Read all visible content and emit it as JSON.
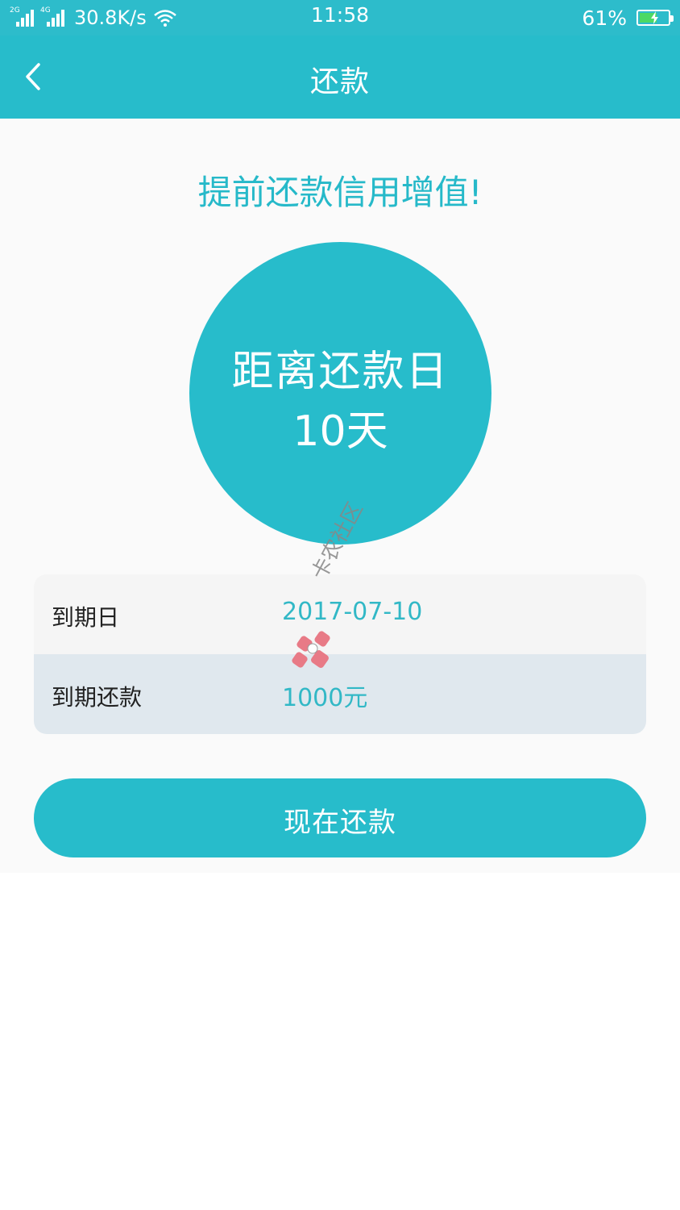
{
  "status_bar": {
    "sim1_gen": "2G",
    "sim2_gen": "4G",
    "net_speed": "30.8K/s",
    "time": "11:58",
    "battery_percent": "61%",
    "battery_level": 0.61
  },
  "nav": {
    "title": "还款",
    "back_icon": "chevron-left-icon"
  },
  "slogan": "提前还款信用增值!",
  "countdown": {
    "label": "距离还款日",
    "days": "10天"
  },
  "info": {
    "rows": [
      {
        "label": "到期日",
        "value": "2017-07-10"
      },
      {
        "label": "到期还款",
        "value": "1000元"
      }
    ]
  },
  "watermark": {
    "text": "卡农社区"
  },
  "actions": {
    "pay_now_label": "现在还款"
  },
  "colors": {
    "primary": "#27bccb",
    "accent_text": "#26b9c9",
    "row_alt": "#e0e8ee"
  }
}
